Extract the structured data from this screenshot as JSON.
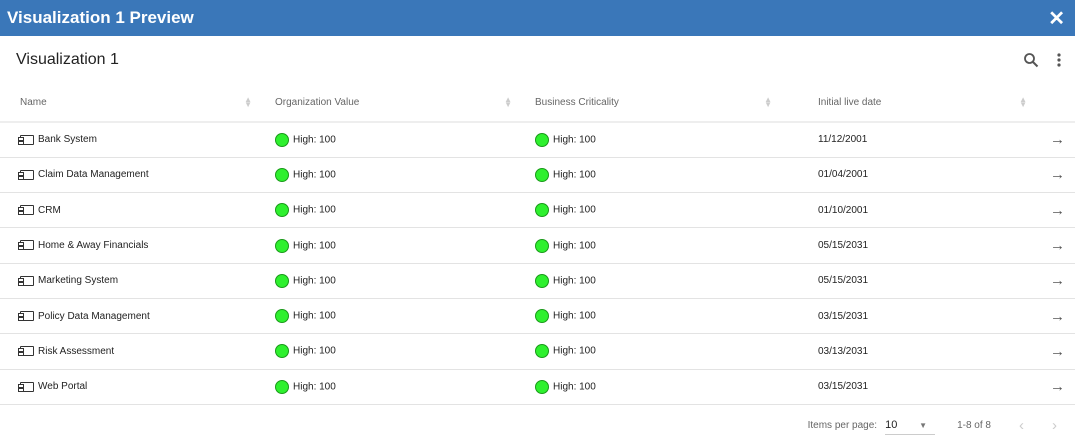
{
  "window": {
    "title": "Visualization 1 Preview"
  },
  "header": {
    "title": "Visualization 1"
  },
  "columns": [
    "Name",
    "Organization Value",
    "Business Criticality",
    "Initial live date"
  ],
  "rows": [
    {
      "name": "Bank System",
      "org": "High: 100",
      "biz": "High: 100",
      "date": "11/12/2001"
    },
    {
      "name": "Claim Data Management",
      "org": "High: 100",
      "biz": "High: 100",
      "date": "01/04/2001"
    },
    {
      "name": "CRM",
      "org": "High: 100",
      "biz": "High: 100",
      "date": "01/10/2001"
    },
    {
      "name": "Home & Away Financials",
      "org": "High: 100",
      "biz": "High: 100",
      "date": "05/15/2031"
    },
    {
      "name": "Marketing System",
      "org": "High: 100",
      "biz": "High: 100",
      "date": "05/15/2031"
    },
    {
      "name": "Policy Data Management",
      "org": "High: 100",
      "biz": "High: 100",
      "date": "03/15/2031"
    },
    {
      "name": "Risk Assessment",
      "org": "High: 100",
      "biz": "High: 100",
      "date": "03/13/2031"
    },
    {
      "name": "Web Portal",
      "org": "High: 100",
      "biz": "High: 100",
      "date": "03/15/2031"
    }
  ],
  "pager": {
    "label": "Items per page:",
    "per_page": "10",
    "range": "1-8 of 8"
  },
  "colors": {
    "accent": "#3a77b9",
    "high": "#2ef02e"
  }
}
